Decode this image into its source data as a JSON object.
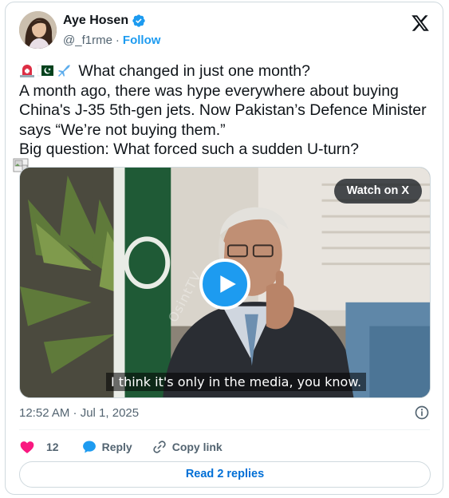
{
  "author": {
    "name": "Aye Hosen",
    "handle": "@_f1rme",
    "separator": "·",
    "follow_label": "Follow",
    "verified_color": "#1d9bf0"
  },
  "tweet": {
    "lines": [
      "What changed in just one month?",
      "A month ago, there was hype everywhere about buying",
      "China's J-35 5th-gen jets. Now Pakistan’s Defence Minister",
      "says “We’re not buying them.”",
      "Big question: What forced such a sudden U-turn?"
    ],
    "leading_emojis": [
      "police-light-icon",
      "pakistan-flag-icon",
      "airplane-icon"
    ]
  },
  "video": {
    "watch_label": "Watch on X",
    "caption": "I think it's only in the media, you know.",
    "watermark": "OsintTV"
  },
  "meta": {
    "timestamp": "12:52 AM · Jul 1, 2025"
  },
  "actions": {
    "like_count": "12",
    "reply_label": "Reply",
    "copy_link_label": "Copy link"
  },
  "read_replies_label": "Read 2 replies",
  "colors": {
    "accent": "#1d9bf0",
    "like": "#f91880",
    "text_secondary": "#536471"
  }
}
